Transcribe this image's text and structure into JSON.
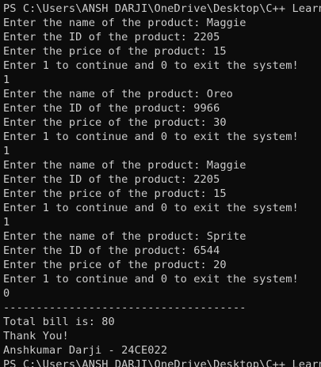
{
  "terminal": {
    "lines": [
      "PS C:\\Users\\ANSH DARJI\\OneDrive\\Desktop\\C++ Learnin",
      "Enter the name of the product: Maggie",
      "Enter the ID of the product: 2205",
      "Enter the price of the product: 15",
      "Enter 1 to continue and 0 to exit the system!",
      "1",
      "Enter the name of the product: Oreo",
      "Enter the ID of the product: 9966",
      "Enter the price of the product: 30",
      "Enter 1 to continue and 0 to exit the system!",
      "1",
      "Enter the name of the product: Maggie",
      "Enter the ID of the product: 2205",
      "Enter the price of the product: 15",
      "Enter 1 to continue and 0 to exit the system!",
      "1",
      "Enter the name of the product: Sprite",
      "Enter the ID of the product: 6544",
      "Enter the price of the product: 20",
      "Enter 1 to continue and 0 to exit the system!",
      "0",
      "-------------------------------------",
      "Total bill is: 80",
      "Thank You!",
      "Anshkumar Darji - 24CE022",
      "PS C:\\Users\\ANSH DARJI\\OneDrive\\Desktop\\C++ Learnin"
    ]
  }
}
